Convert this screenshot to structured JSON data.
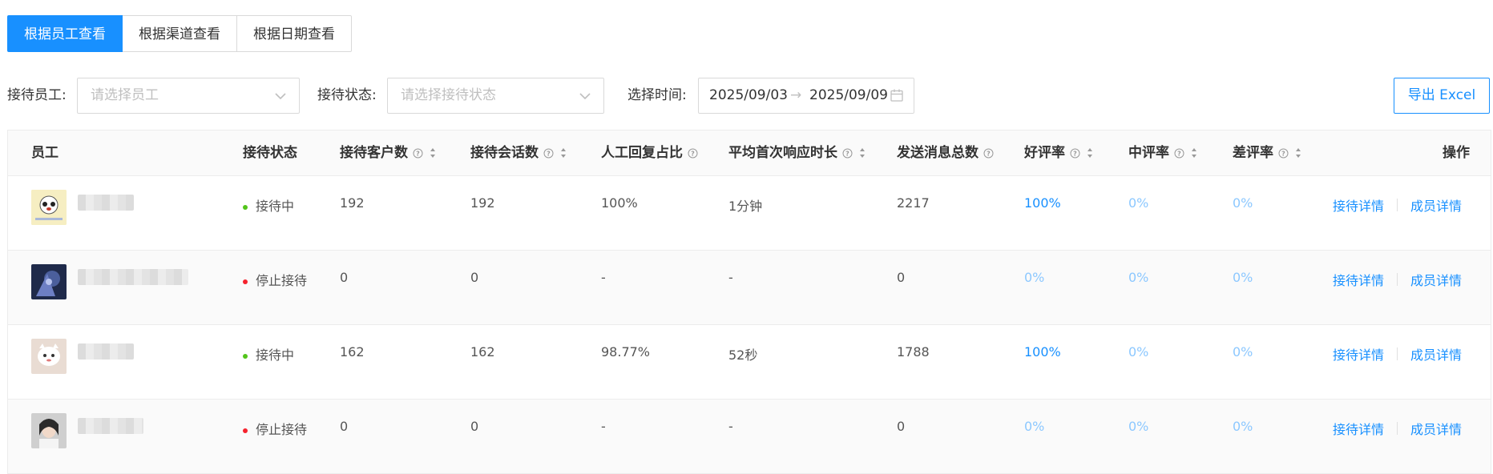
{
  "tabs": [
    {
      "label": "根据员工查看",
      "active": true
    },
    {
      "label": "根据渠道查看",
      "active": false
    },
    {
      "label": "根据日期查看",
      "active": false
    }
  ],
  "filters": {
    "employee_label": "接待员工:",
    "employee_placeholder": "请选择员工",
    "status_label": "接待状态:",
    "status_placeholder": "请选择接待状态",
    "time_label": "选择时间:",
    "date_start": "2025/09/03",
    "date_arrow": "→",
    "date_end": "2025/09/09",
    "export_label": "导出 Excel"
  },
  "columns": {
    "employee": "员工",
    "status": "接待状态",
    "customers": "接待客户数",
    "sessions": "接待会话数",
    "manual_ratio": "人工回复占比",
    "avg_first_response": "平均首次响应时长",
    "messages": "发送消息总数",
    "good_rate": "好评率",
    "mid_rate": "中评率",
    "bad_rate": "差评率",
    "actions": "操作"
  },
  "rows": [
    {
      "status": "接待中",
      "customers": "192",
      "sessions": "192",
      "manual_ratio": "100%",
      "avg_first_response": "1分钟",
      "messages": "2217",
      "good_rate": "100%",
      "mid_rate": "0%",
      "bad_rate": "0%"
    },
    {
      "status": "停止接待",
      "customers": "0",
      "sessions": "0",
      "manual_ratio": "-",
      "avg_first_response": "-",
      "messages": "0",
      "good_rate": "0%",
      "mid_rate": "0%",
      "bad_rate": "0%"
    },
    {
      "status": "接待中",
      "customers": "162",
      "sessions": "162",
      "manual_ratio": "98.77%",
      "avg_first_response": "52秒",
      "messages": "1788",
      "good_rate": "100%",
      "mid_rate": "0%",
      "bad_rate": "0%"
    },
    {
      "status": "停止接待",
      "customers": "0",
      "sessions": "0",
      "manual_ratio": "-",
      "avg_first_response": "-",
      "messages": "0",
      "good_rate": "0%",
      "mid_rate": "0%",
      "bad_rate": "0%"
    }
  ],
  "row_actions": {
    "detail": "接待详情",
    "member": "成员详情"
  },
  "icons": {
    "dropdown": "chevron-down-icon",
    "calendar": "calendar-icon",
    "help": "question-circle-icon",
    "sort": "sort-caret-icon"
  },
  "colors": {
    "primary": "#1890ff",
    "primary_light": "#8cc8ff",
    "status_active": "#52c41a",
    "status_stopped": "#f5222d"
  }
}
